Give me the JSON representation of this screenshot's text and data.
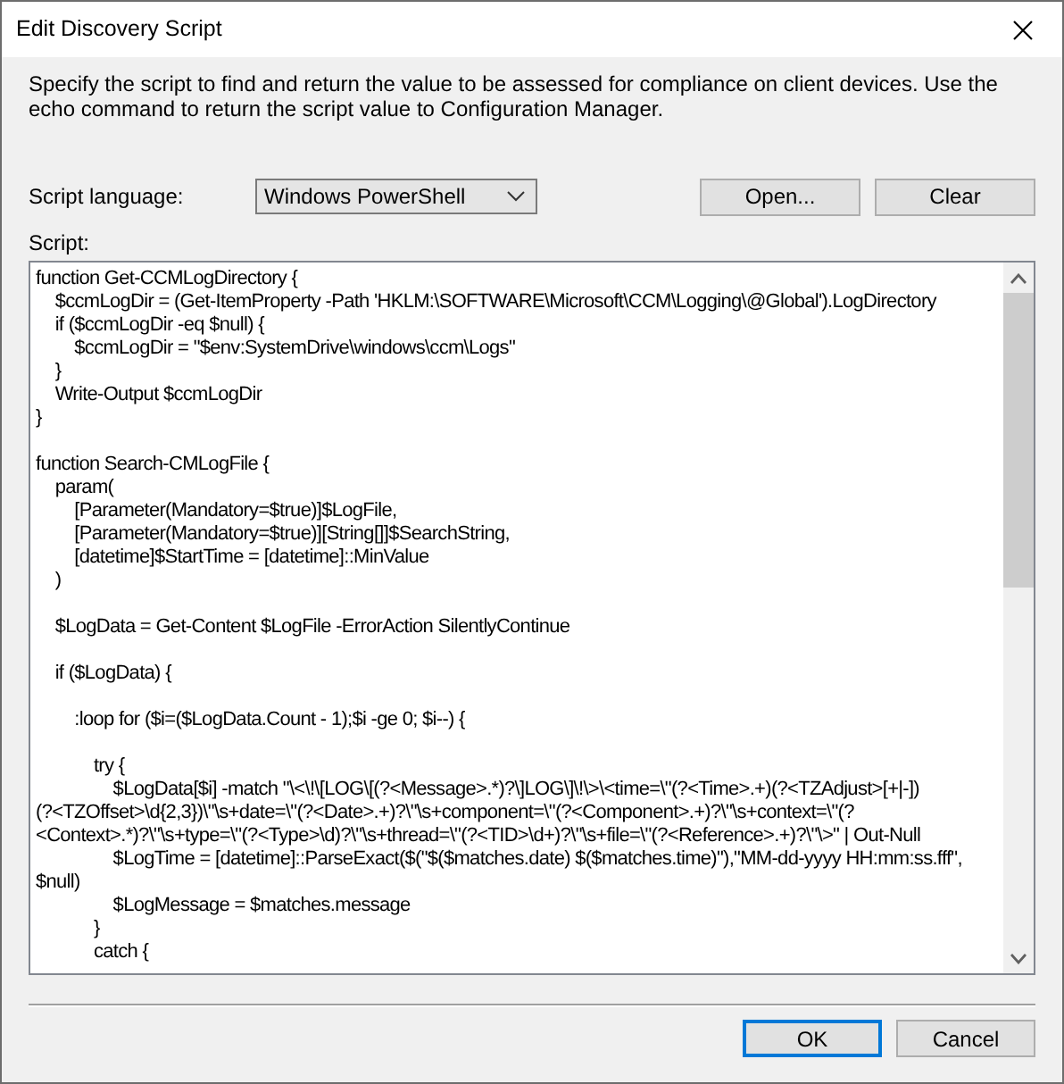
{
  "window": {
    "title": "Edit Discovery Script"
  },
  "description": "Specify the script to find and return the value to be assessed for compliance on client devices. Use the echo command to return the script value to Configuration Manager.",
  "script_language": {
    "label": "Script language:",
    "value": "Windows PowerShell"
  },
  "buttons": [
    {
      "label": "Open..."
    },
    {
      "label": "Clear"
    }
  ],
  "script": {
    "label": "Script:",
    "blocks": [
      [
        "function Get-CCMLogDirectory {",
        "    $ccmLogDir = (Get-ItemProperty -Path 'HKLM:\\SOFTWARE\\Microsoft\\CCM\\Logging\\@Global').LogDirectory",
        "    if ($ccmLogDir -eq $null) {",
        "        $ccmLogDir = \"$env:SystemDrive\\windows\\ccm\\Logs\"",
        "    }",
        "    Write-Output $ccmLogDir",
        "}"
      ],
      [
        "function Search-CMLogFile {",
        "    param(",
        "        [Parameter(Mandatory=$true)]$LogFile,",
        "        [Parameter(Mandatory=$true)][String[]]$SearchString,",
        "        [datetime]$StartTime = [datetime]::MinValue",
        "    )"
      ],
      [
        "    $LogData = Get-Content $LogFile -ErrorAction SilentlyContinue"
      ],
      [
        "    if ($LogData) {"
      ],
      [
        "        :loop for ($i=($LogData.Count - 1);$i -ge 0; $i--) {"
      ],
      [
        "            try {",
        "                $LogData[$i] -match \"\\<\\!\\[LOG\\[(?<Message>.*)?\\]LOG\\]\\!\\>\\<time=\\\"(?<Time>.+)(?<TZAdjust>[+|-])",
        "(?<TZOffset>\\d{2,3})\\\"\\s+date=\\\"(?<Date>.+)?\\\"\\s+component=\\\"(?<Component>.+)?\\\"\\s+context=\\\"(?",
        "<Context>.*)?\\\"\\s+type=\\\"(?<Type>\\d)?\\\"\\s+thread=\\\"(?<TID>\\d+)?\\\"\\s+file=\\\"(?<Reference>.+)?\\\"\\>\" | Out-Null",
        "                $LogTime = [datetime]::ParseExact($(\"$($matches.date) $($matches.time)\"),\"MM-dd-yyyy HH:mm:ss.fff\",",
        "$null)",
        "                $LogMessage = $matches.message",
        "            }",
        "            catch {"
      ]
    ]
  },
  "footer_buttons": [
    {
      "label": "OK",
      "default": true
    },
    {
      "label": "Cancel",
      "default": false
    }
  ]
}
